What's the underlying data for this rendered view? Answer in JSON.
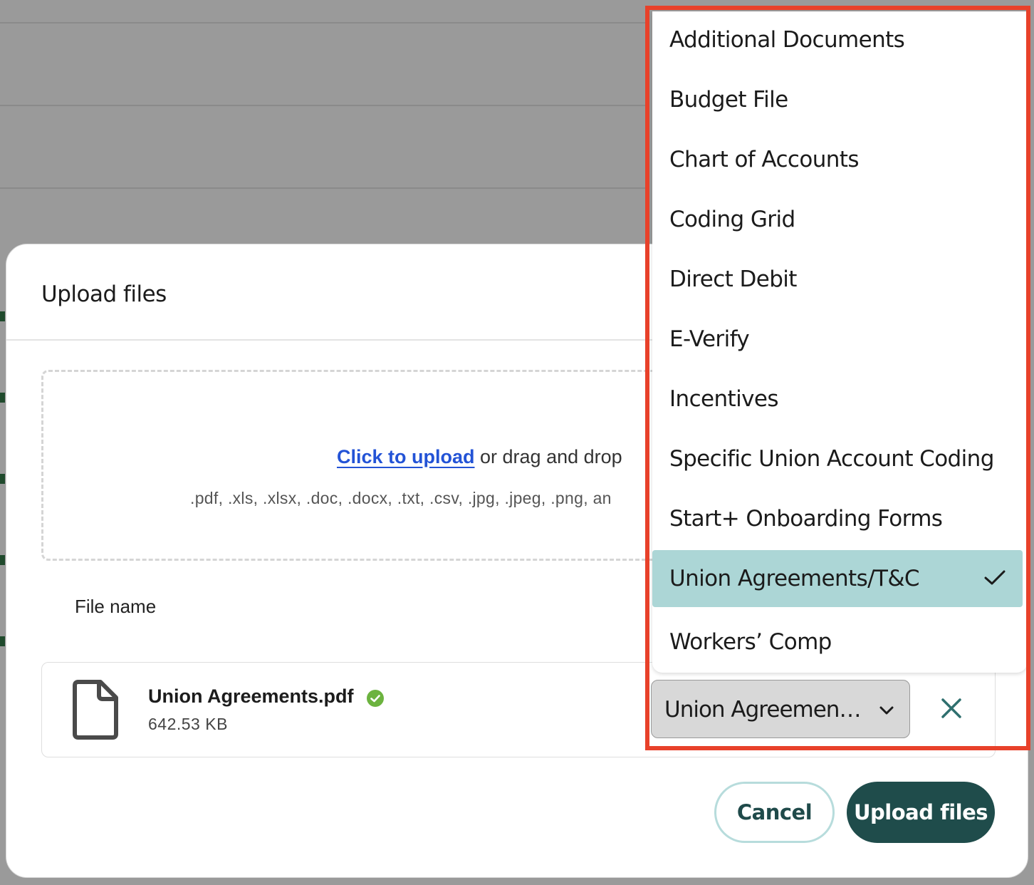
{
  "modal": {
    "title": "Upload files",
    "dropzone": {
      "link_text": "Click to upload",
      "rest_text": " or drag and drop",
      "file_types": ".pdf, .xls, .xlsx, .doc, .docx, .txt, .csv, .jpg, .jpeg, .png, an"
    },
    "column_header": "File name",
    "file": {
      "name": "Union Agreements.pdf",
      "size": "642.53 KB",
      "status_icon": "check-circle-icon",
      "type_value": "Union Agreements/T&C"
    },
    "buttons": {
      "cancel": "Cancel",
      "upload": "Upload files"
    }
  },
  "dropdown": {
    "items": [
      "Additional Documents",
      "Budget File",
      "Chart of Accounts",
      "Coding Grid",
      "Direct Debit",
      "E-Verify",
      "Incentives",
      "Specific Union Account Coding",
      "Start+ Onboarding Forms",
      "Union Agreements/T&C",
      "Workers’ Comp"
    ],
    "selected": "Union Agreements/T&C"
  },
  "colors": {
    "primary": "#1f4c4b",
    "selected_bg": "#acd6d6",
    "link": "#2353d6",
    "success": "#6cb33f",
    "highlight": "#e8412a"
  }
}
